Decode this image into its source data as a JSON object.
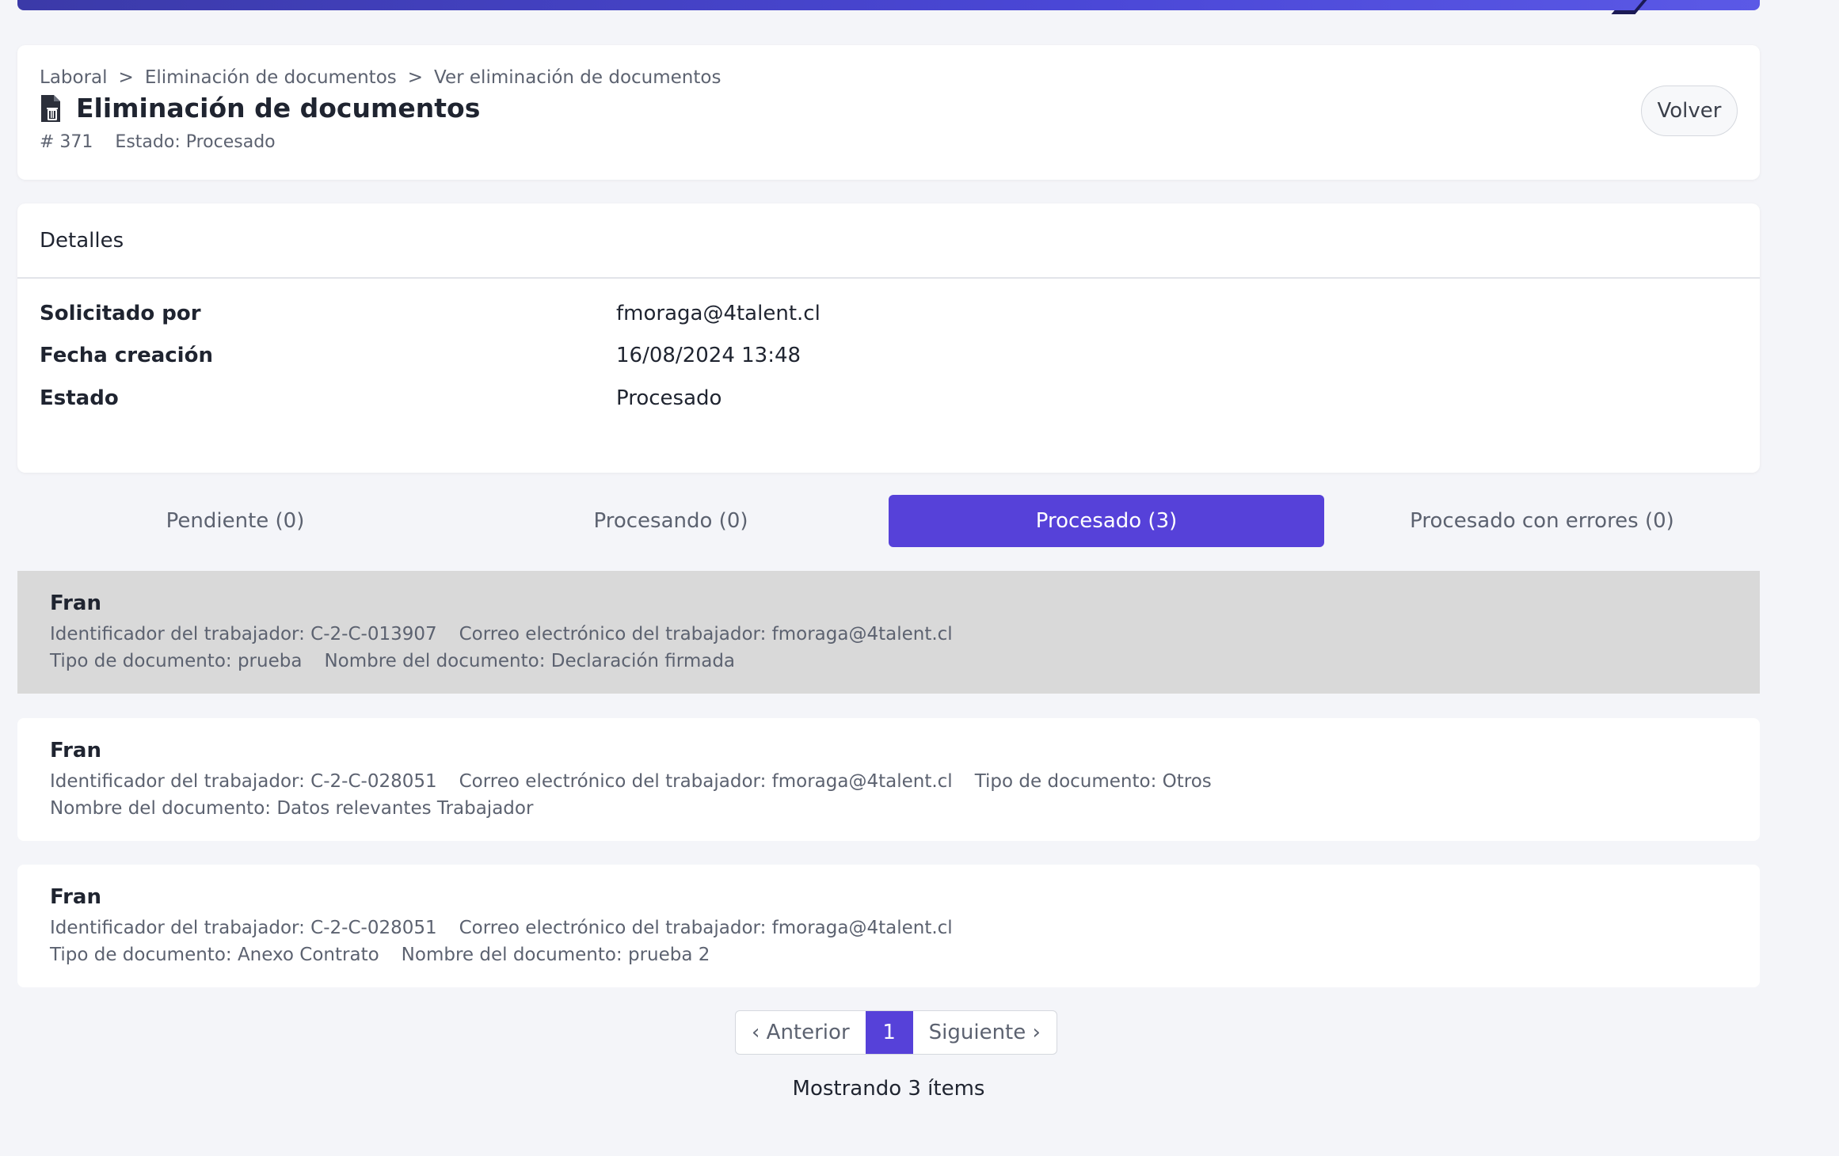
{
  "breadcrumb": {
    "items": [
      "Laboral",
      "Eliminación de documentos",
      "Ver eliminación de documentos"
    ],
    "separator": ">"
  },
  "header": {
    "title": "Eliminación de documentos",
    "id_label": "# 371",
    "status_label": "Estado: Procesado",
    "back_label": "Volver",
    "icon": "document-delete-icon"
  },
  "details": {
    "heading": "Detalles",
    "rows": [
      {
        "label": "Solicitado por",
        "value": "fmoraga@4talent.cl"
      },
      {
        "label": "Fecha creación",
        "value": "16/08/2024 13:48"
      },
      {
        "label": "Estado",
        "value": "Procesado"
      }
    ]
  },
  "tabs": [
    {
      "label": "Pendiente (0)",
      "active": false
    },
    {
      "label": "Procesando (0)",
      "active": false
    },
    {
      "label": "Procesado (3)",
      "active": true
    },
    {
      "label": "Procesado con errores (0)",
      "active": false
    }
  ],
  "items": [
    {
      "name": "Fran",
      "line1": [
        "Identificador del trabajador: C-2-C-013907",
        "Correo electrónico del trabajador: fmoraga@4talent.cl"
      ],
      "line2": [
        "Tipo de documento: prueba",
        "Nombre del documento: Declaración firmada"
      ]
    },
    {
      "name": "Fran",
      "line1": [
        "Identificador del trabajador: C-2-C-028051",
        "Correo electrónico del trabajador: fmoraga@4talent.cl",
        "Tipo de documento: Otros"
      ],
      "line2": [
        "Nombre del documento: Datos relevantes Trabajador"
      ]
    },
    {
      "name": "Fran",
      "line1": [
        "Identificador del trabajador: C-2-C-028051",
        "Correo electrónico del trabajador: fmoraga@4talent.cl"
      ],
      "line2": [
        "Tipo de documento: Anexo Contrato",
        "Nombre del documento: prueba 2"
      ]
    }
  ],
  "pagination": {
    "prev_label": "‹ Anterior",
    "current_page": "1",
    "next_label": "Siguiente ›",
    "summary": "Mostrando 3 ítems"
  },
  "colors": {
    "accent": "#5641d9",
    "selected_row": "#d9d9d9",
    "background": "#f4f5f9"
  }
}
